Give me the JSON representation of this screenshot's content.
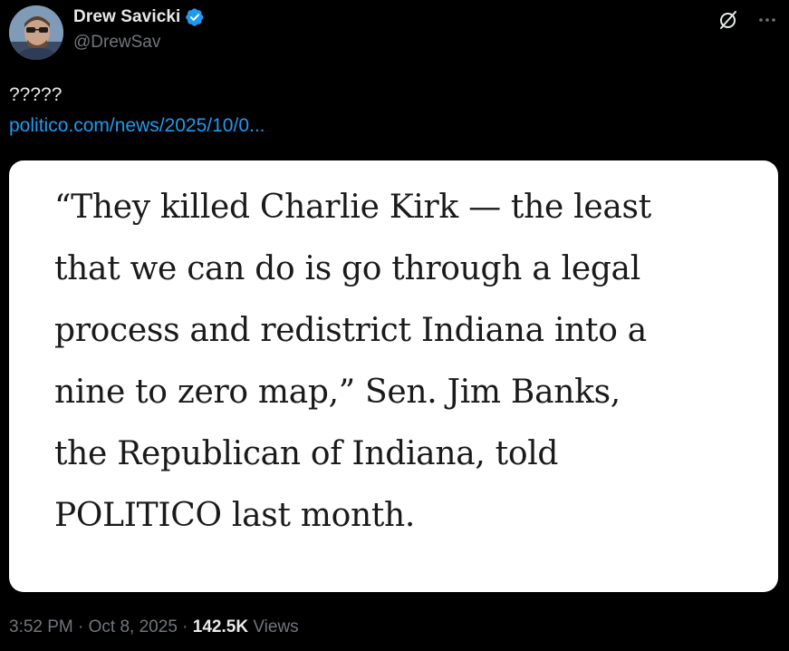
{
  "author": {
    "display_name": "Drew Savicki",
    "handle": "@DrewSav",
    "verified": true
  },
  "tweet": {
    "text": "?????",
    "link_text": "politico.com/news/2025/10/0..."
  },
  "media": {
    "quote_lines": [
      "“They killed Charlie Kirk — the least",
      "that we can do is go through a legal",
      "process and redistrict Indiana into a",
      "nine to zero map,” Sen. Jim Banks,",
      "the Republican of Indiana, told",
      "POLITICO last month."
    ]
  },
  "meta": {
    "time": "3:52 PM",
    "separator": "·",
    "date": "Oct 8, 2025",
    "views_count": "142.5K",
    "views_label": "Views"
  },
  "icons": {
    "verified": "verified-badge-icon",
    "grok": "grok-icon",
    "more": "more-icon"
  },
  "colors": {
    "background": "#000000",
    "primary_text": "#e7e9ea",
    "secondary_text": "#71767b",
    "link": "#1d9bf0",
    "verified": "#1d9bf0"
  }
}
